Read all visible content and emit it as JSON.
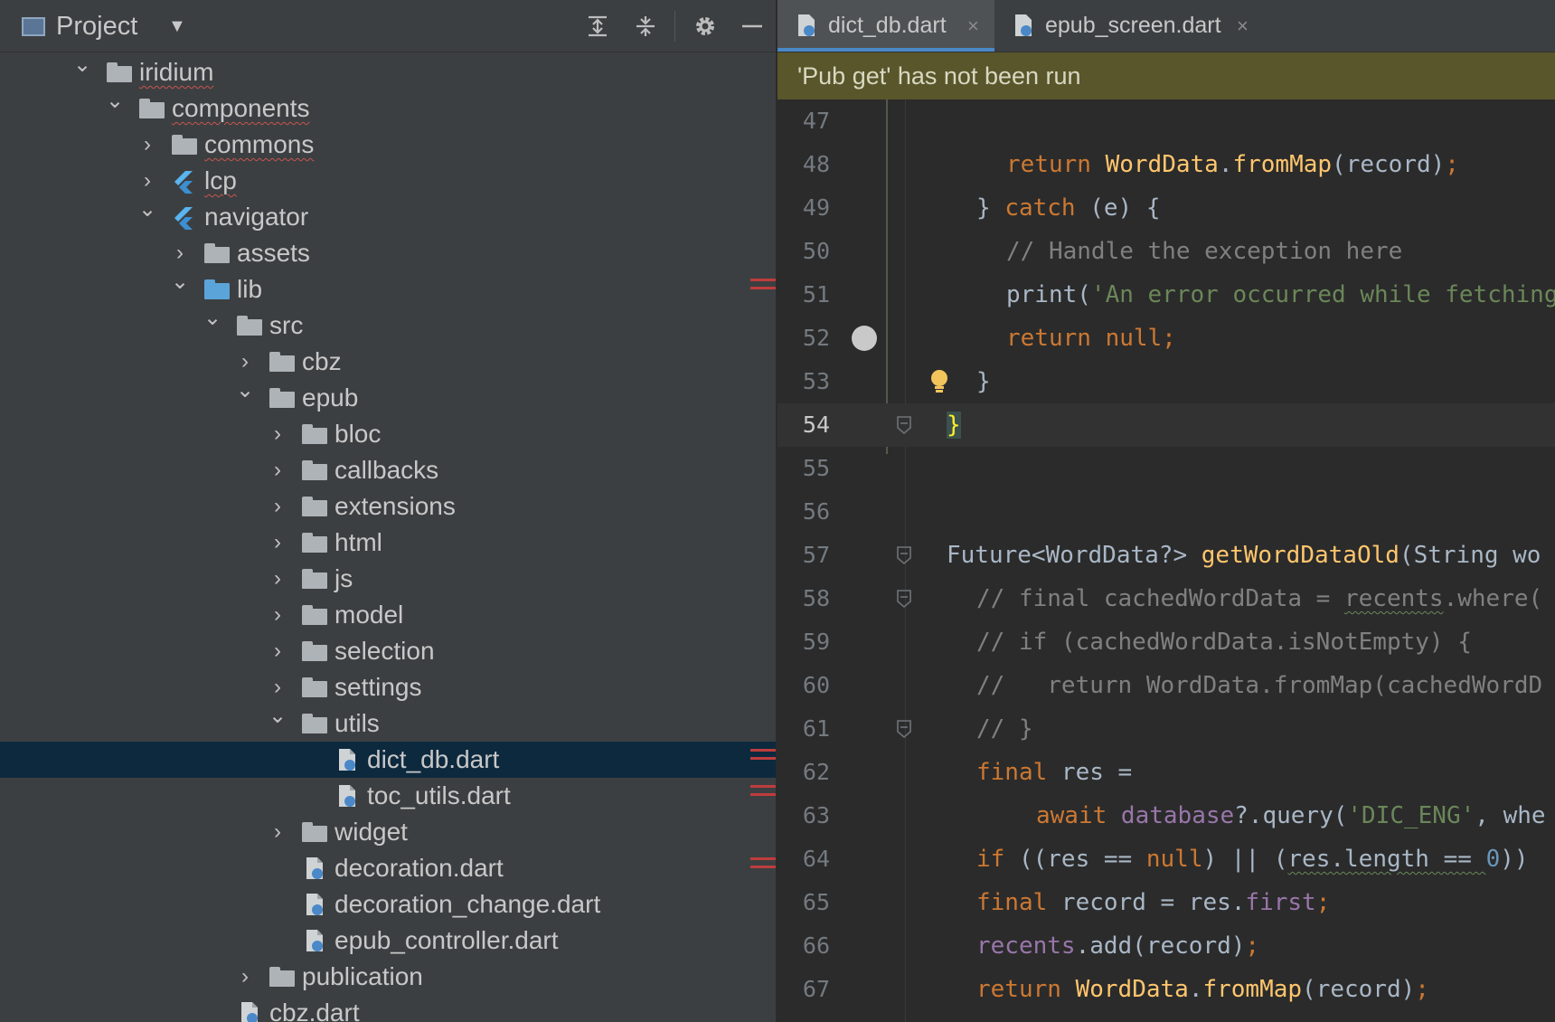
{
  "project_panel": {
    "title": "Project",
    "buttons": [
      "expand-all",
      "collapse-all",
      "settings",
      "hide"
    ],
    "tree": [
      {
        "label": "iridium",
        "depth": 0,
        "arrow": "down",
        "icon": "module-folder",
        "squiggle": true
      },
      {
        "label": "components",
        "depth": 1,
        "arrow": "down",
        "icon": "folder",
        "squiggle": true
      },
      {
        "label": "commons",
        "depth": 2,
        "arrow": "right",
        "icon": "folder",
        "squiggle": true
      },
      {
        "label": "lcp",
        "depth": 2,
        "arrow": "right",
        "icon": "flutter",
        "squiggle": true
      },
      {
        "label": "navigator",
        "depth": 2,
        "arrow": "down",
        "icon": "flutter"
      },
      {
        "label": "assets",
        "depth": 3,
        "arrow": "right",
        "icon": "folder"
      },
      {
        "label": "lib",
        "depth": 3,
        "arrow": "down",
        "icon": "folder-blue",
        "error": true
      },
      {
        "label": "src",
        "depth": 4,
        "arrow": "down",
        "icon": "folder"
      },
      {
        "label": "cbz",
        "depth": 5,
        "arrow": "right",
        "icon": "folder"
      },
      {
        "label": "epub",
        "depth": 5,
        "arrow": "down",
        "icon": "folder"
      },
      {
        "label": "bloc",
        "depth": 6,
        "arrow": "right",
        "icon": "folder"
      },
      {
        "label": "callbacks",
        "depth": 6,
        "arrow": "right",
        "icon": "folder"
      },
      {
        "label": "extensions",
        "depth": 6,
        "arrow": "right",
        "icon": "folder"
      },
      {
        "label": "html",
        "depth": 6,
        "arrow": "right",
        "icon": "folder"
      },
      {
        "label": "js",
        "depth": 6,
        "arrow": "right",
        "icon": "folder"
      },
      {
        "label": "model",
        "depth": 6,
        "arrow": "right",
        "icon": "folder"
      },
      {
        "label": "selection",
        "depth": 6,
        "arrow": "right",
        "icon": "folder"
      },
      {
        "label": "settings",
        "depth": 6,
        "arrow": "right",
        "icon": "folder"
      },
      {
        "label": "utils",
        "depth": 6,
        "arrow": "down",
        "icon": "folder"
      },
      {
        "label": "dict_db.dart",
        "depth": 7,
        "arrow": "",
        "icon": "dart",
        "selected": true,
        "error": true
      },
      {
        "label": "toc_utils.dart",
        "depth": 7,
        "arrow": "",
        "icon": "dart",
        "error": true
      },
      {
        "label": "widget",
        "depth": 6,
        "arrow": "right",
        "icon": "folder"
      },
      {
        "label": "decoration.dart",
        "depth": 6,
        "arrow": "",
        "icon": "dart",
        "error": true
      },
      {
        "label": "decoration_change.dart",
        "depth": 6,
        "arrow": "",
        "icon": "dart"
      },
      {
        "label": "epub_controller.dart",
        "depth": 6,
        "arrow": "",
        "icon": "dart"
      },
      {
        "label": "publication",
        "depth": 5,
        "arrow": "right",
        "icon": "folder"
      },
      {
        "label": "cbz.dart",
        "depth": 4,
        "arrow": "",
        "icon": "dart"
      }
    ]
  },
  "editor": {
    "tabs": [
      {
        "label": "dict_db.dart",
        "active": true
      },
      {
        "label": "epub_screen.dart",
        "active": false
      }
    ],
    "close_glyph": "×",
    "banner": "'Pub get' has not been run",
    "current_line": "54",
    "lines": [
      {
        "n": "47",
        "indent": 0,
        "tokens": []
      },
      {
        "n": "48",
        "indent": 2,
        "tokens": [
          [
            "kw",
            "return "
          ],
          [
            "fn",
            "WordData"
          ],
          [
            "cls",
            "."
          ],
          [
            "fn",
            "fromMap"
          ],
          [
            "cls",
            "(record)"
          ],
          [
            "kw",
            ";"
          ]
        ]
      },
      {
        "n": "49",
        "indent": 1,
        "tokens": [
          [
            "cls",
            "} "
          ],
          [
            "kw",
            "catch "
          ],
          [
            "cls",
            "(e) {"
          ]
        ]
      },
      {
        "n": "50",
        "indent": 2,
        "tokens": [
          [
            "cm",
            "// Handle the exception here"
          ]
        ]
      },
      {
        "n": "51",
        "indent": 2,
        "tokens": [
          [
            "cls",
            "print("
          ],
          [
            "str",
            "'An error occurred while fetching"
          ]
        ]
      },
      {
        "n": "52",
        "indent": 2,
        "tokens": [
          [
            "kw",
            "return null;"
          ]
        ],
        "error": true,
        "breakpoint": true
      },
      {
        "n": "53",
        "indent": 1,
        "tokens": [
          [
            "cls",
            "}"
          ]
        ],
        "bulb": true
      },
      {
        "n": "54",
        "indent": 0,
        "tokens": [
          [
            "brace",
            "}"
          ]
        ],
        "current": true,
        "fold": true
      },
      {
        "n": "55",
        "indent": 0,
        "tokens": []
      },
      {
        "n": "56",
        "indent": 0,
        "tokens": []
      },
      {
        "n": "57",
        "indent": 0,
        "tokens": [
          [
            "cls",
            "Future<WordData?> "
          ],
          [
            "fn",
            "getWordDataOld"
          ],
          [
            "cls",
            "(String wo"
          ]
        ],
        "fold": true
      },
      {
        "n": "58",
        "indent": 1,
        "tokens": [
          [
            "cm",
            "// final cachedWordData = "
          ],
          [
            "cmw",
            "recents"
          ],
          [
            "cm",
            ".where("
          ]
        ],
        "fold": true
      },
      {
        "n": "59",
        "indent": 1,
        "tokens": [
          [
            "cm",
            "// if (cachedWordData.isNotEmpty) {"
          ]
        ]
      },
      {
        "n": "60",
        "indent": 1,
        "tokens": [
          [
            "cm",
            "//   return WordData.fromMap(cachedWordD"
          ]
        ]
      },
      {
        "n": "61",
        "indent": 1,
        "tokens": [
          [
            "cm",
            "// }"
          ]
        ],
        "fold": true
      },
      {
        "n": "62",
        "indent": 1,
        "tokens": [
          [
            "kw",
            "final "
          ],
          [
            "cls",
            "res ="
          ]
        ]
      },
      {
        "n": "63",
        "indent": 3,
        "tokens": [
          [
            "kw",
            "await "
          ],
          [
            "field",
            "database"
          ],
          [
            "cls",
            "?.query("
          ],
          [
            "str",
            "'DIC_ENG'"
          ],
          [
            "cls",
            ", whe"
          ]
        ]
      },
      {
        "n": "64",
        "indent": 1,
        "tokens": [
          [
            "kw",
            "if "
          ],
          [
            "cls",
            "((res == "
          ],
          [
            "kw",
            "null"
          ],
          [
            "cls",
            ") || ("
          ],
          [
            "wv",
            "res.length == "
          ],
          [
            "num",
            "0"
          ],
          [
            "cls",
            "))"
          ]
        ]
      },
      {
        "n": "65",
        "indent": 1,
        "tokens": [
          [
            "kw",
            "final "
          ],
          [
            "cls",
            "record = res."
          ],
          [
            "field",
            "first"
          ],
          [
            "kw",
            ";"
          ]
        ]
      },
      {
        "n": "66",
        "indent": 1,
        "tokens": [
          [
            "field",
            "recents"
          ],
          [
            "cls",
            ".add(record)"
          ],
          [
            "kw",
            ";"
          ]
        ]
      },
      {
        "n": "67",
        "indent": 1,
        "tokens": [
          [
            "kw",
            "return "
          ],
          [
            "fn",
            "WordData"
          ],
          [
            "cls",
            "."
          ],
          [
            "fn",
            "fromMap"
          ],
          [
            "cls",
            "(record)"
          ],
          [
            "kw",
            ";"
          ]
        ]
      }
    ]
  }
}
